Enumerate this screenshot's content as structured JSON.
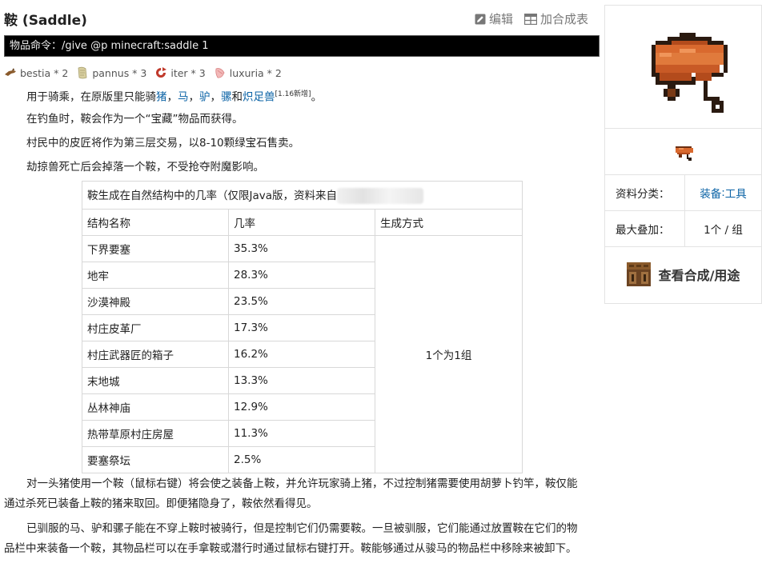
{
  "page": {
    "title": "鞍 (Saddle)",
    "actions": {
      "edit": "编辑",
      "add_recipe": "加合成表"
    },
    "command": "物品命令：/give @p minecraft:saddle 1"
  },
  "requirements": [
    {
      "name": "bestia * 2",
      "icon": "bestia-aspect-icon",
      "color": "#8a5a2b"
    },
    {
      "name": "pannus * 3",
      "icon": "pannus-aspect-icon",
      "color": "#d8cfa0"
    },
    {
      "name": "iter * 3",
      "icon": "iter-aspect-icon",
      "color": "#c0392b"
    },
    {
      "name": "luxuria * 2",
      "icon": "luxuria-aspect-icon",
      "color": "#e8a0a0"
    }
  ],
  "paragraphs": {
    "p1": {
      "pre": "用于骑乘，在原版里只能骑",
      "l1": "猪",
      "s1": "，",
      "l2": "马",
      "s2": "，",
      "l3": "驴",
      "s3": "，",
      "l4": "骡",
      "s4": "和",
      "l5": "炽足兽",
      "sup": "[1.16新增]",
      "end": "。"
    },
    "p2": "在钓鱼时，鞍会作为一个“宝藏”物品而获得。",
    "p3": "村民中的皮匠将作为第三层交易，以8-10颗绿宝石售卖。",
    "p4": "劫掠兽死亡后会掉落一个鞍，不受抢夺附魔影响。",
    "p5_line1": "对一头猪使用一个鞍（鼠标右键）将会使之装备上鞍，并允许玩家骑上猪，不过控制猪需要使用胡萝卜钓竿，鞍仅能",
    "p5_line2": "通过杀死已装备上鞍的猪来取回。即便猪隐身了，鞍依然看得见。",
    "p6_line1": "已驯服的马、驴和骡子能在不穿上鞍时被骑行，但是控制它们仍需要鞍。一旦被驯服，它们能通过放置鞍在它们的物",
    "p6_line2": "品栏中来装备一个鞍，其物品栏可以在手拿鞍或潜行时通过鼠标右键打开。鞍能够通过从骏马的物品栏中移除来被卸下。"
  },
  "table": {
    "caption": "鞍生成在自然结构中的几率（仅限Java版，资料来自",
    "headers": [
      "结构名称",
      "几率",
      "生成方式"
    ],
    "rows": [
      {
        "name": "下界要塞",
        "chance": "35.3%"
      },
      {
        "name": "地牢",
        "chance": "28.3%"
      },
      {
        "name": "沙漠神殿",
        "chance": "23.5%"
      },
      {
        "name": "村庄皮革厂",
        "chance": "17.3%"
      },
      {
        "name": "村庄武器匠的箱子",
        "chance": "16.2%"
      },
      {
        "name": "末地城",
        "chance": "13.3%"
      },
      {
        "name": "丛林神庙",
        "chance": "12.9%"
      },
      {
        "name": "热带草原村庄房屋",
        "chance": "11.3%"
      },
      {
        "name": "要塞祭坛",
        "chance": "2.5%"
      }
    ],
    "method": "1个为1组"
  },
  "infobox": {
    "category_label": "资料分类：",
    "category_value_a": "装备",
    "category_sep": ":",
    "category_value_b": "工具",
    "stack_label": "最大叠加：",
    "stack_value": "1个 / 组",
    "recipe_button": "查看合成/用途",
    "saddle_color": "#d9692e"
  }
}
